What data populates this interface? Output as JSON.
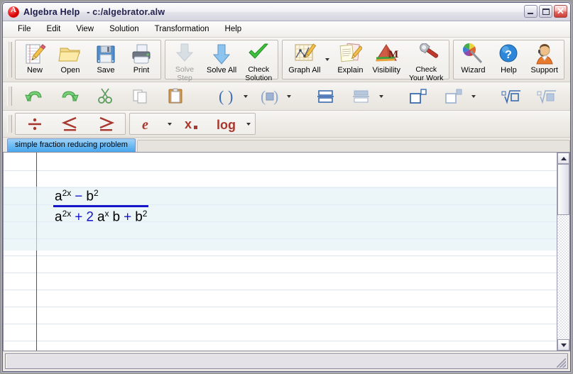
{
  "window": {
    "app_title": "Algebra Help",
    "file_path": "- c:/algebrator.alw",
    "app_icon": "algebrator-red-a-icon",
    "controls": {
      "minimize": "minimize-button",
      "maximize": "maximize-button",
      "close": "close-button",
      "close_glyph": "✕"
    }
  },
  "menu": {
    "items": [
      {
        "label": "File"
      },
      {
        "label": "Edit"
      },
      {
        "label": "View"
      },
      {
        "label": "Solution"
      },
      {
        "label": "Transformation"
      },
      {
        "label": "Help"
      }
    ]
  },
  "toolbar_main": {
    "groups": [
      {
        "buttons": [
          {
            "label": "New",
            "icon": "new-document-icon",
            "disabled": false,
            "dropdown": false
          },
          {
            "label": "Open",
            "icon": "open-folder-icon",
            "disabled": false,
            "dropdown": false
          },
          {
            "label": "Save",
            "icon": "floppy-disk-icon",
            "disabled": false,
            "dropdown": false
          },
          {
            "label": "Print",
            "icon": "printer-icon",
            "disabled": false,
            "dropdown": false
          }
        ]
      },
      {
        "buttons": [
          {
            "label": "Solve\nStep",
            "line1": "Solve",
            "line2": "Step",
            "icon": "down-arrow-icon",
            "disabled": true,
            "dropdown": false
          },
          {
            "label": "Solve All",
            "line1": "Solve All",
            "line2": "",
            "icon": "down-arrow-icon",
            "disabled": false,
            "dropdown": false
          },
          {
            "label": "Check\nSolution",
            "line1": "Check",
            "line2": "Solution",
            "icon": "green-check-icon",
            "disabled": false,
            "dropdown": false
          }
        ]
      },
      {
        "buttons": [
          {
            "label": "Graph All",
            "line1": "Graph All",
            "line2": "",
            "icon": "graph-pencil-icon",
            "disabled": false,
            "dropdown": true
          },
          {
            "label": "Explain",
            "line1": "Explain",
            "line2": "",
            "icon": "explain-pages-icon",
            "disabled": false,
            "dropdown": false
          },
          {
            "label": "Visibility",
            "line1": "Visibility",
            "line2": "",
            "icon": "visibility-m-icon",
            "disabled": false,
            "dropdown": false
          },
          {
            "label": "Check\nYour Work",
            "line1": "Check",
            "line2": "Your Work",
            "icon": "wrench-icon",
            "disabled": false,
            "dropdown": false
          }
        ]
      },
      {
        "buttons": [
          {
            "label": "Wizard",
            "line1": "Wizard",
            "line2": "",
            "icon": "color-wheel-wand-icon",
            "disabled": false,
            "dropdown": false
          },
          {
            "label": "Help",
            "line1": "Help",
            "line2": "",
            "icon": "blue-question-icon",
            "disabled": false,
            "dropdown": false
          },
          {
            "label": "Support",
            "line1": "Support",
            "line2": "",
            "icon": "support-person-icon",
            "disabled": false,
            "dropdown": false
          }
        ]
      }
    ]
  },
  "toolbar_edit": {
    "buttons": [
      {
        "icon": "undo-arrow-icon",
        "disabled": false,
        "dropdown": false
      },
      {
        "icon": "redo-arrow-icon",
        "disabled": false,
        "dropdown": false
      },
      {
        "icon": "scissors-cut-icon",
        "disabled": true,
        "dropdown": false
      },
      {
        "icon": "copy-pages-icon",
        "disabled": true,
        "dropdown": false
      },
      {
        "icon": "paste-clipboard-icon",
        "disabled": false,
        "dropdown": false
      },
      {
        "icon": "parentheses-icon",
        "disabled": false,
        "dropdown": true
      },
      {
        "icon": "parentheses-filled-icon",
        "disabled": true,
        "dropdown": true
      },
      {
        "icon": "fraction-stack-icon",
        "disabled": false,
        "dropdown": false
      },
      {
        "icon": "fraction-stack-light-icon",
        "disabled": true,
        "dropdown": true
      },
      {
        "icon": "exponent-icon",
        "disabled": false,
        "dropdown": false
      },
      {
        "icon": "exponent-light-icon",
        "disabled": true,
        "dropdown": true
      },
      {
        "icon": "radical-icon",
        "disabled": false,
        "dropdown": false
      },
      {
        "icon": "radical-light-icon",
        "disabled": true,
        "dropdown": false
      },
      {
        "icon": "absolute-value-icon",
        "disabled": false,
        "dropdown": false
      },
      {
        "icon": "absolute-value-light-icon",
        "disabled": true,
        "dropdown": false
      },
      {
        "icon": "small-fraction-icon",
        "disabled": false,
        "dropdown": false
      }
    ]
  },
  "toolbar_math": {
    "buttons": [
      {
        "glyph": "÷",
        "icon": "divide-icon",
        "dropdown": false
      },
      {
        "glyph": "≤",
        "icon": "less-equal-icon",
        "dropdown": false
      },
      {
        "glyph": "≥",
        "icon": "greater-equal-icon",
        "dropdown": false
      },
      {
        "glyph": "e",
        "icon": "exponential-e-icon",
        "dropdown": true
      },
      {
        "glyph": "x",
        "icon": "subscript-x-icon",
        "dropdown": false
      },
      {
        "glyph": "log",
        "icon": "logarithm-icon",
        "dropdown": true
      }
    ]
  },
  "tabs": {
    "items": [
      {
        "label": "simple fraction reducing problem",
        "active": true
      }
    ]
  },
  "document": {
    "expression": {
      "numerator": [
        {
          "t": "a",
          "type": "var"
        },
        {
          "t": "2x",
          "type": "sup"
        },
        {
          "t": "−",
          "type": "op"
        },
        {
          "t": "b",
          "type": "var"
        },
        {
          "t": "2",
          "type": "sup"
        }
      ],
      "denominator": [
        {
          "t": "a",
          "type": "var"
        },
        {
          "t": "2x",
          "type": "sup"
        },
        {
          "t": "+",
          "type": "op"
        },
        {
          "t": "2",
          "type": "op"
        },
        {
          "t": "a",
          "type": "var"
        },
        {
          "t": "x",
          "type": "sup"
        },
        {
          "t": "b",
          "type": "var"
        },
        {
          "t": "+",
          "type": "op"
        },
        {
          "t": "b",
          "type": "var"
        },
        {
          "t": "2",
          "type": "sup"
        }
      ],
      "numerator_text": "a^(2x) - b^2",
      "denominator_text": "a^(2x) + 2 a^x b + b^2",
      "fraction_bar_color": "#1414c8",
      "operator_color": "#1414c8",
      "variable_color": "#000000"
    }
  },
  "scrollbar": {
    "up_arrow": "scroll-up-arrow-icon",
    "down_arrow": "scroll-down-arrow-icon",
    "thumb": "vertical-scroll-thumb"
  },
  "statusbar": {
    "text": "",
    "grip": "resize-grip-icon"
  }
}
